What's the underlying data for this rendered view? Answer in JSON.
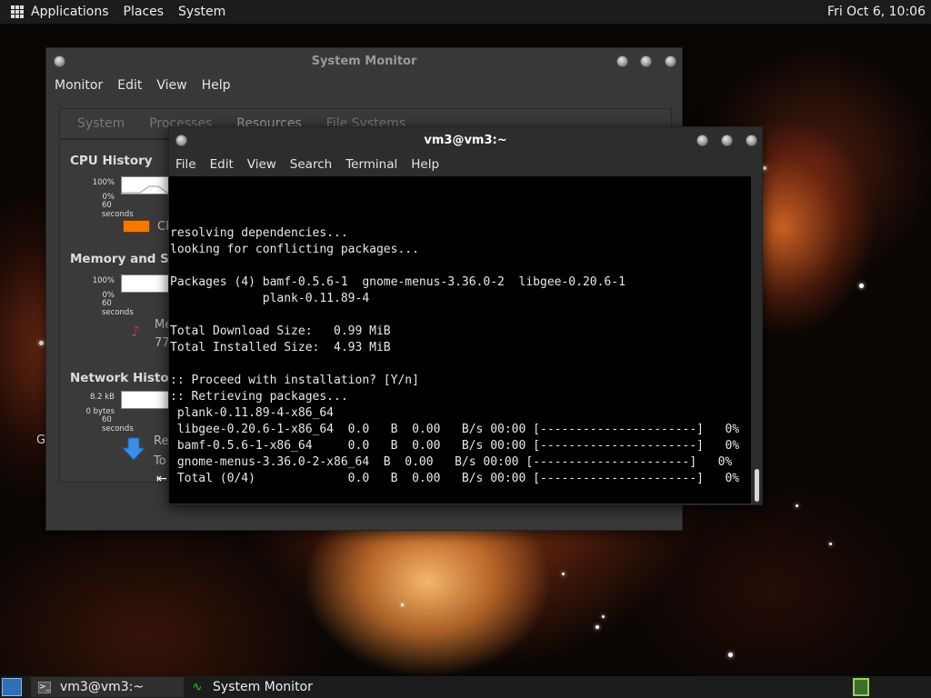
{
  "top_panel": {
    "menus": [
      "Applications",
      "Places",
      "System"
    ],
    "clock": "Fri Oct  6, 10:06"
  },
  "system_monitor": {
    "title": "System Monitor",
    "menus": [
      "Monitor",
      "Edit",
      "View",
      "Help"
    ],
    "tabs": [
      "System",
      "Processes",
      "Resources",
      "File Systems"
    ],
    "sections": {
      "cpu": {
        "title": "CPU History",
        "max": "100%",
        "min": "0%",
        "time": "60 seconds",
        "legend_partial": "CF",
        "color": "#f57900"
      },
      "memory": {
        "title": "Memory and Swap",
        "max": "100%",
        "min": "0%",
        "time": "60 seconds",
        "label_partial": "Me",
        "value_partial": "77"
      },
      "network": {
        "title": "Network History",
        "max": "8.2 kB",
        "min": "0 bytes",
        "time": "60 seconds",
        "label_partial": "Re",
        "value_partial": "To"
      }
    },
    "left_edge_partial": "G"
  },
  "terminal": {
    "title": "vm3@vm3:~",
    "menus": [
      "File",
      "Edit",
      "View",
      "Search",
      "Terminal",
      "Help"
    ],
    "lines": [
      "",
      "",
      "",
      "resolving dependencies...",
      "looking for conflicting packages...",
      "",
      "Packages (4) bamf-0.5.6-1  gnome-menus-3.36.0-2  libgee-0.20.6-1",
      "             plank-0.11.89-4",
      "",
      "Total Download Size:   0.99 MiB",
      "Total Installed Size:  4.93 MiB",
      "",
      ":: Proceed with installation? [Y/n]",
      ":: Retrieving packages...",
      " plank-0.11.89-4-x86_64",
      " libgee-0.20.6-1-x86_64  0.0   B  0.00   B/s 00:00 [----------------------]   0%",
      " bamf-0.5.6-1-x86_64     0.0   B  0.00   B/s 00:00 [----------------------]   0%",
      " gnome-menus-3.36.0-2-x86_64  B  0.00   B/s 00:00 [----------------------]   0%",
      " Total (0/4)             0.0   B  0.00   B/s 00:00 [----------------------]   0%"
    ]
  },
  "taskbar": {
    "tasks": [
      "vm3@vm3:~",
      "System Monitor"
    ]
  }
}
